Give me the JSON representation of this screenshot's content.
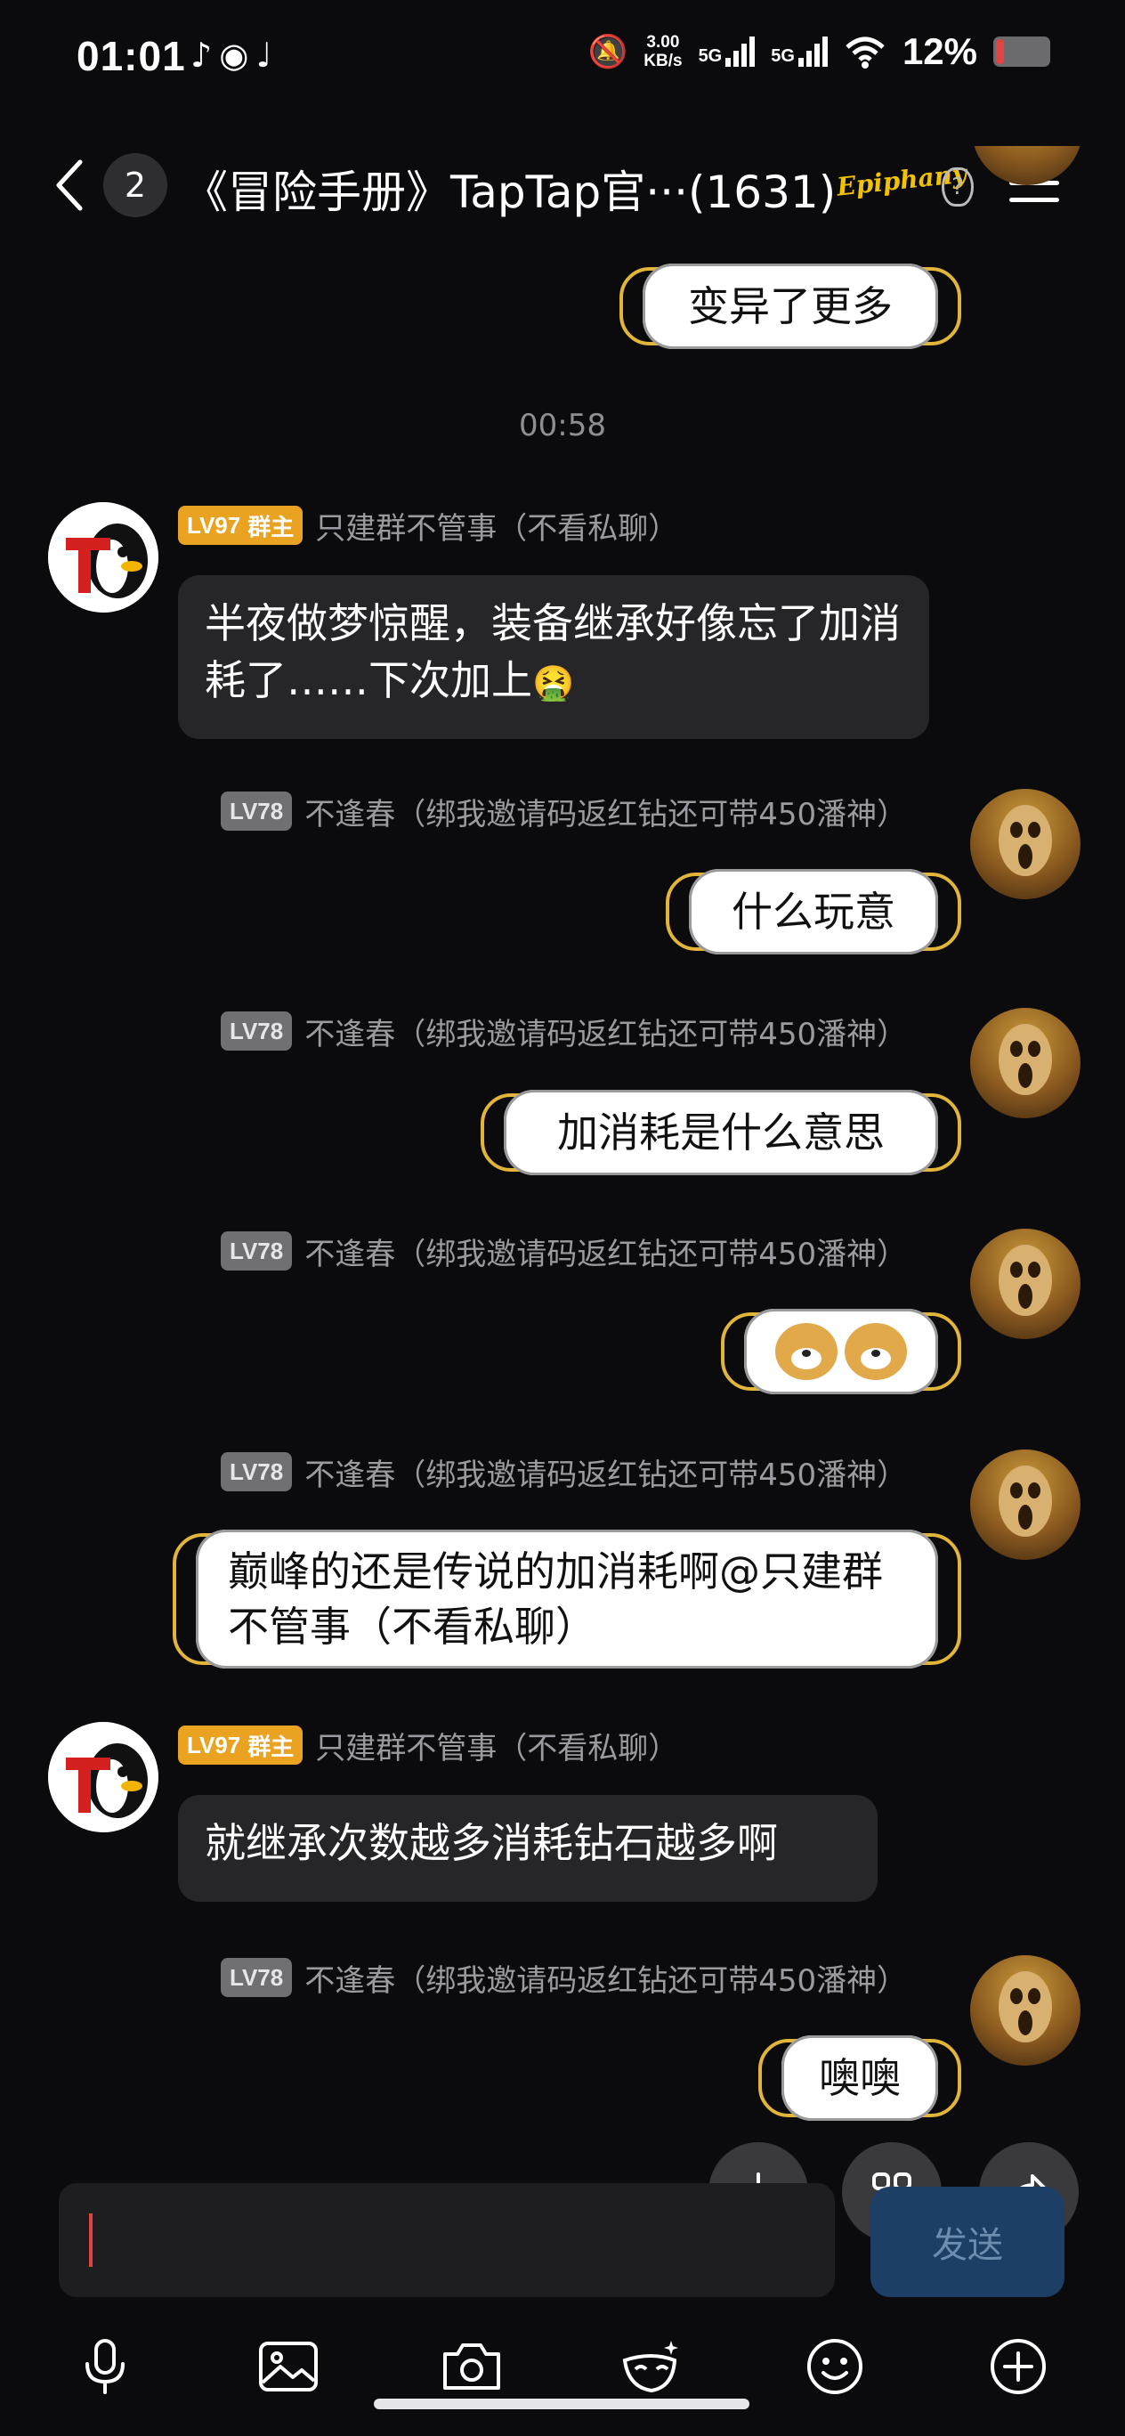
{
  "status_bar": {
    "time": "01:01",
    "app_icons": [
      "netease-icon",
      "wechat-icon",
      "tiktok-icon"
    ],
    "speed_value": "3.00",
    "speed_unit": "KB/s",
    "signal1": "5G",
    "signal2": "5G",
    "battery": "12%"
  },
  "header": {
    "back_badge": "2",
    "title": "《冒险手册》TapTap官···(1631)",
    "logo_text": "Epiphany",
    "help_glyph": "?"
  },
  "messages": {
    "m0": {
      "text": "变异了更多"
    },
    "time_sep": "00:58",
    "m1": {
      "level": "LV97",
      "role": "群主",
      "sender": "只建群不管事（不看私聊）",
      "text": "半夜做梦惊醒，装备继承好像忘了加消耗了……下次加上",
      "emoji": "🤮"
    },
    "m2": {
      "level": "LV78",
      "sender": "不逢春（绑我邀请码返红钻还可带450潘神）",
      "text": "什么玩意"
    },
    "m3": {
      "level": "LV78",
      "sender": "不逢春（绑我邀请码返红钻还可带450潘神）",
      "text": "加消耗是什么意思"
    },
    "m4": {
      "level": "LV78",
      "sender": "不逢春（绑我邀请码返红钻还可带450潘神）"
    },
    "m5": {
      "level": "LV78",
      "sender": "不逢春（绑我邀请码返红钻还可带450潘神）",
      "text": "巅峰的还是传说的加消耗啊@只建群不管事（不看私聊）"
    },
    "m6": {
      "level": "LV97",
      "role": "群主",
      "sender": "只建群不管事（不看私聊）",
      "text": "就继承次数越多消耗钻石越多啊"
    },
    "m7": {
      "level": "LV78",
      "sender": "不逢春（绑我邀请码返红钻还可带450潘神）",
      "text": "噢噢"
    }
  },
  "composer": {
    "send_label": "发送"
  },
  "colors": {
    "background": "#0b0b0d",
    "owner_badge": "#e9a321",
    "level_badge": "#707074",
    "bubble_border": "#e1b43a",
    "send_button": "#1d3f66"
  }
}
